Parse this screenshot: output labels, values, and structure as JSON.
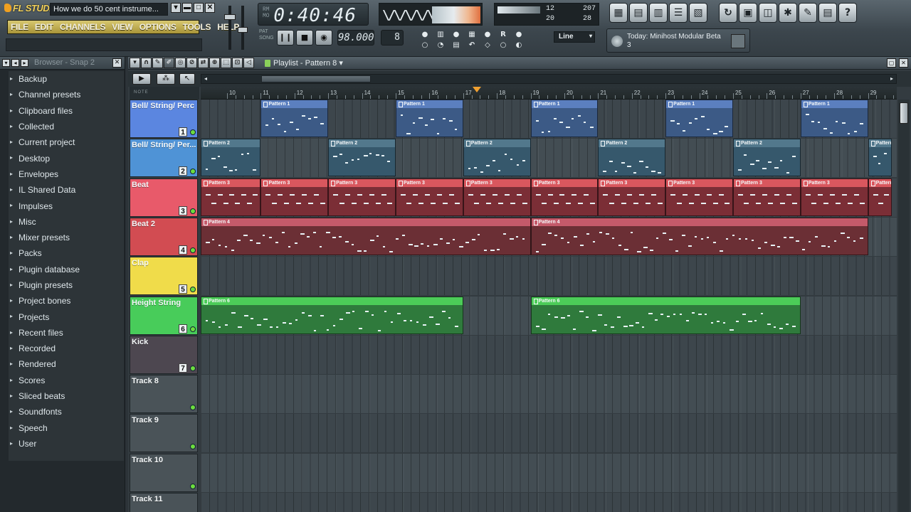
{
  "app": {
    "logo": "FL STUDIO",
    "window_title": "How we do 50 cent instrume...",
    "window_buttons": [
      "▾",
      "▬",
      "□",
      "✕"
    ]
  },
  "menu": [
    "FILE",
    "EDIT",
    "CHANNELS",
    "VIEW",
    "OPTIONS",
    "TOOLS",
    "HELP"
  ],
  "transport": {
    "time": "0:40:46",
    "time_small_top": "RM",
    "time_small_bottom": "MO",
    "mode_pat": "PAT",
    "mode_song": "SONG",
    "tempo": "98.000",
    "snap_value": "8",
    "pause_icon": "❙❙",
    "stop_icon": "■",
    "record_icon": "◉"
  },
  "monitor": {
    "cpu": "12",
    "voices": "20",
    "polyphony": "207",
    "mem": "28"
  },
  "line_select": {
    "value": "Line",
    "chevron": "▾"
  },
  "news": {
    "line1": "Today: Minihost Modular Beta",
    "line2": "3"
  },
  "browser": {
    "title": "Browser - Snap 2",
    "items": [
      {
        "label": "Backup",
        "highlight": true
      },
      {
        "label": "Channel presets",
        "highlight": false
      },
      {
        "label": "Clipboard files",
        "highlight": false
      },
      {
        "label": "Collected",
        "highlight": false
      },
      {
        "label": "Current project",
        "highlight": true
      },
      {
        "label": "Desktop",
        "highlight": false
      },
      {
        "label": "Envelopes",
        "highlight": false
      },
      {
        "label": "IL Shared Data",
        "highlight": false
      },
      {
        "label": "Impulses",
        "highlight": false
      },
      {
        "label": "Misc",
        "highlight": false
      },
      {
        "label": "Mixer presets",
        "highlight": false
      },
      {
        "label": "Packs",
        "highlight": false
      },
      {
        "label": "Plugin database",
        "highlight": false
      },
      {
        "label": "Plugin presets",
        "highlight": false
      },
      {
        "label": "Project bones",
        "highlight": true
      },
      {
        "label": "Projects",
        "highlight": false
      },
      {
        "label": "Recent files",
        "highlight": true
      },
      {
        "label": "Recorded",
        "highlight": false
      },
      {
        "label": "Rendered",
        "highlight": false
      },
      {
        "label": "Scores",
        "highlight": false
      },
      {
        "label": "Sliced beats",
        "highlight": false
      },
      {
        "label": "Soundfonts",
        "highlight": false
      },
      {
        "label": "Speech",
        "highlight": false
      },
      {
        "label": "User",
        "highlight": false
      }
    ]
  },
  "playlist": {
    "title": "Playlist - Pattern 8",
    "ruler_label": "NOTE",
    "ruler": [
      "10",
      "11",
      "12",
      "13",
      "14",
      "15",
      "16",
      "17",
      "18",
      "19",
      "20",
      "21",
      "22",
      "23",
      "24",
      "25",
      "26",
      "27",
      "28",
      "29"
    ],
    "tracks": [
      {
        "name": "Bell/ String/ Perc",
        "number": "1",
        "color": "#5b86e0"
      },
      {
        "name": "Bell/ String/ Per...",
        "number": "2",
        "color": "#4f93d6"
      },
      {
        "name": "Beat",
        "number": "3",
        "color": "#e85a6a"
      },
      {
        "name": "Beat 2",
        "number": "4",
        "color": "#d24c52"
      },
      {
        "name": "Clap",
        "number": "5",
        "color": "#f0dc4a"
      },
      {
        "name": "Height String",
        "number": "6",
        "color": "#48cc5a"
      },
      {
        "name": "Kick",
        "number": "7",
        "color": "#4d4750"
      },
      {
        "name": "Track 8",
        "number": "",
        "color": "#4a5358"
      },
      {
        "name": "Track 9",
        "number": "",
        "color": "#4a5358"
      },
      {
        "name": "Track 10",
        "number": "",
        "color": "#4a5358"
      },
      {
        "name": "Track 11",
        "number": "",
        "color": "#4a5358"
      }
    ],
    "clips": [
      {
        "track": 0,
        "label": "Pattern 1",
        "start": 11.0,
        "len": 2.0,
        "color": "blue"
      },
      {
        "track": 0,
        "label": "Pattern 1",
        "start": 15.0,
        "len": 2.0,
        "color": "blue"
      },
      {
        "track": 0,
        "label": "Pattern 1",
        "start": 19.0,
        "len": 2.0,
        "color": "blue"
      },
      {
        "track": 0,
        "label": "Pattern 1",
        "start": 23.0,
        "len": 2.0,
        "color": "blue"
      },
      {
        "track": 0,
        "label": "Pattern 1",
        "start": 27.0,
        "len": 2.0,
        "color": "blue"
      },
      {
        "track": 1,
        "label": "Pattern 2",
        "start": 9.0,
        "len": 2.0,
        "color": "teal"
      },
      {
        "track": 1,
        "label": "Pattern 2",
        "start": 13.0,
        "len": 2.0,
        "color": "teal"
      },
      {
        "track": 1,
        "label": "Pattern 2",
        "start": 17.0,
        "len": 2.0,
        "color": "teal"
      },
      {
        "track": 1,
        "label": "Pattern 2",
        "start": 21.0,
        "len": 2.0,
        "color": "teal"
      },
      {
        "track": 1,
        "label": "Pattern 2",
        "start": 25.0,
        "len": 2.0,
        "color": "teal"
      },
      {
        "track": 1,
        "label": "Pattern",
        "start": 29.0,
        "len": 0.7,
        "color": "teal"
      },
      {
        "track": 2,
        "label": "Pattern 3",
        "start": 9.0,
        "len": 2.0,
        "color": "red"
      },
      {
        "track": 2,
        "label": "Pattern 3",
        "start": 11.0,
        "len": 2.0,
        "color": "red"
      },
      {
        "track": 2,
        "label": "Pattern 3",
        "start": 13.0,
        "len": 2.0,
        "color": "red"
      },
      {
        "track": 2,
        "label": "Pattern 3",
        "start": 15.0,
        "len": 2.0,
        "color": "red"
      },
      {
        "track": 2,
        "label": "Pattern 3",
        "start": 17.0,
        "len": 2.0,
        "color": "red"
      },
      {
        "track": 2,
        "label": "Pattern 3",
        "start": 19.0,
        "len": 2.0,
        "color": "red"
      },
      {
        "track": 2,
        "label": "Pattern 3",
        "start": 21.0,
        "len": 2.0,
        "color": "red"
      },
      {
        "track": 2,
        "label": "Pattern 3",
        "start": 23.0,
        "len": 2.0,
        "color": "red"
      },
      {
        "track": 2,
        "label": "Pattern 3",
        "start": 25.0,
        "len": 2.0,
        "color": "red"
      },
      {
        "track": 2,
        "label": "Pattern 3",
        "start": 27.0,
        "len": 2.0,
        "color": "red"
      },
      {
        "track": 2,
        "label": "Pattern",
        "start": 29.0,
        "len": 0.7,
        "color": "red"
      },
      {
        "track": 3,
        "label": "Pattern 4",
        "start": 9.0,
        "len": 10.0,
        "color": "maroon"
      },
      {
        "track": 3,
        "label": "Pattern 4",
        "start": 19.0,
        "len": 10.0,
        "color": "maroon"
      },
      {
        "track": 5,
        "label": "Pattern 6",
        "start": 9.0,
        "len": 8.0,
        "color": "green"
      },
      {
        "track": 5,
        "label": "Pattern 6",
        "start": 19.0,
        "len": 8.0,
        "color": "green"
      }
    ]
  },
  "icons": {
    "toolbar_right": [
      "piano-roll-icon",
      "channel-rack-icon",
      "mixer-icon",
      "playlist-icon",
      "step-sequencer-icon",
      "recycle-icon",
      "save-icon",
      "export-icon",
      "settings-icon",
      "wrench-icon",
      "notes-icon",
      "help-icon"
    ]
  }
}
